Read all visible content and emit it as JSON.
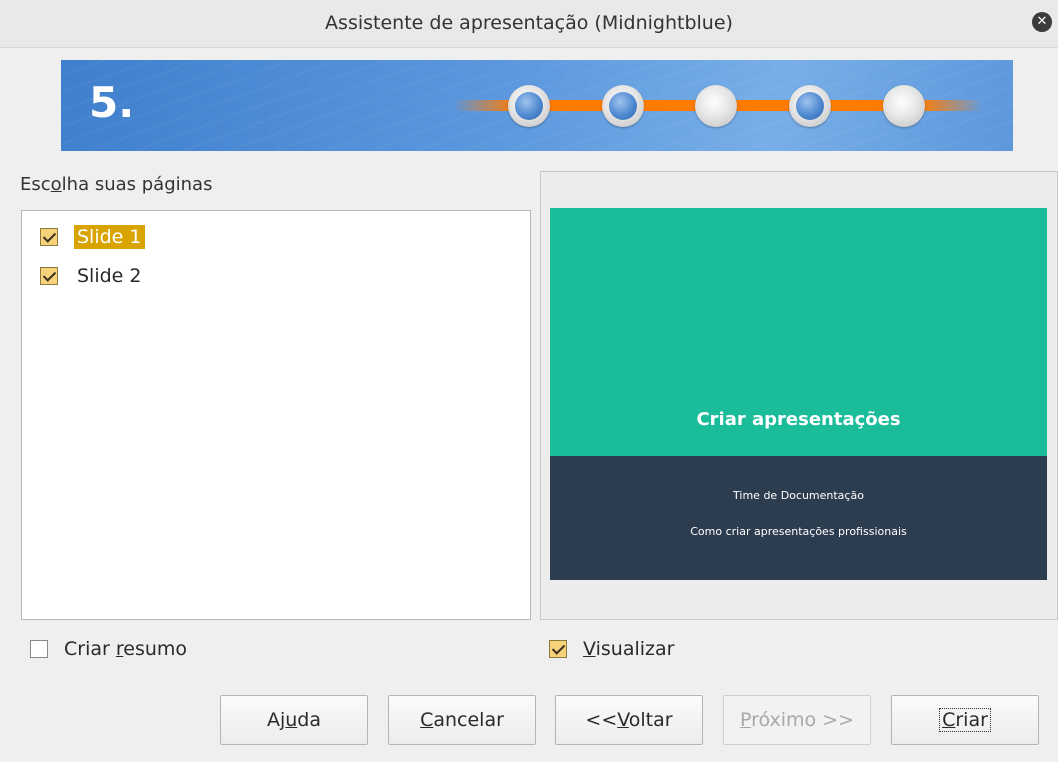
{
  "window": {
    "title": "Assistente de apresentação (Midnightblue)"
  },
  "banner": {
    "step_number": "5.",
    "steps": [
      {
        "state": "done"
      },
      {
        "state": "done"
      },
      {
        "state": "pending"
      },
      {
        "state": "done"
      },
      {
        "state": "pending"
      }
    ]
  },
  "pages_section": {
    "label_pre": "Esc",
    "label_accel": "o",
    "label_post": "lha suas páginas",
    "items": [
      {
        "label": "Slide 1",
        "checked": true,
        "selected": true
      },
      {
        "label": "Slide 2",
        "checked": true,
        "selected": false
      }
    ]
  },
  "preview": {
    "slide_title": "Criar apresentações",
    "slide_line1": "Time de Documentação",
    "slide_line2": "Como criar apresentações profissionais",
    "colors": {
      "top": "#1abc9a",
      "bottom": "#2d3d50"
    }
  },
  "options": {
    "summary_pre": "Criar ",
    "summary_accel": "r",
    "summary_post": "esumo",
    "summary_checked": false,
    "preview_accel": "V",
    "preview_post": "isualizar",
    "preview_checked": true
  },
  "buttons": {
    "help_pre": "Aj",
    "help_accel": "u",
    "help_post": "da",
    "cancel_accel": "C",
    "cancel_post": "ancelar",
    "back_pre": "<<",
    "back_accel": "V",
    "back_post": "oltar",
    "next_accel": "P",
    "next_post": "róximo >>",
    "create_accel": "C",
    "create_post": "riar"
  },
  "accent_color": "#d9a300"
}
